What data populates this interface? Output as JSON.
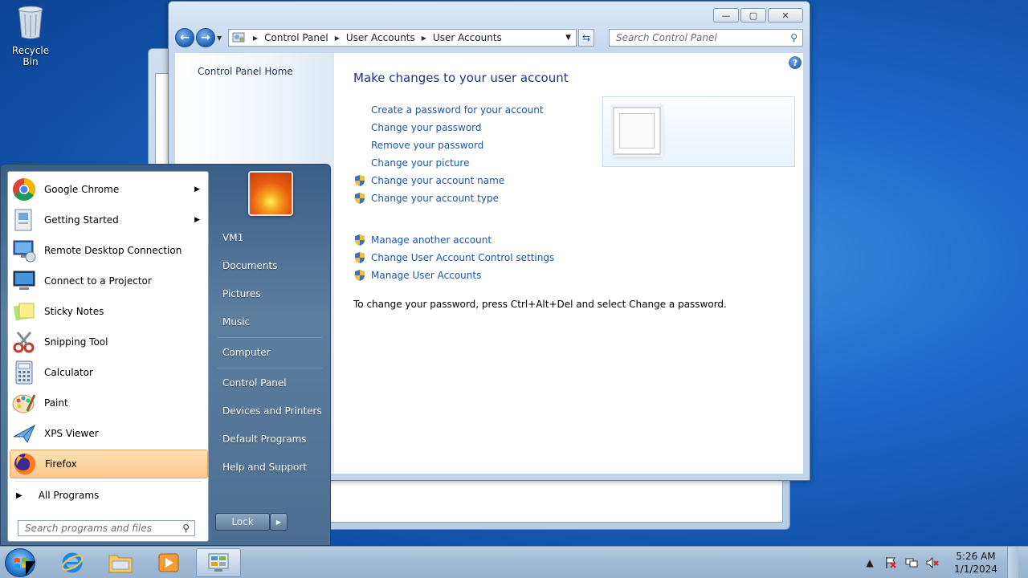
{
  "desktop": {
    "recycle_bin_label": "Recycle Bin"
  },
  "window": {
    "address": [
      "Control Panel",
      "User Accounts",
      "User Accounts"
    ],
    "search_placeholder": "Search Control Panel",
    "left_pane": {
      "home_link": "Control Panel Home"
    },
    "help_glyph": "?",
    "heading": "Make changes to your user account",
    "links": [
      {
        "label": "Create a password for your account",
        "shield": false
      },
      {
        "label": "Change your password",
        "shield": false
      },
      {
        "label": "Remove your password",
        "shield": false
      },
      {
        "label": "Change your picture",
        "shield": false
      },
      {
        "label": "Change your account name",
        "shield": true
      },
      {
        "label": "Change your account type",
        "shield": true
      }
    ],
    "links2": [
      {
        "label": "Manage another account",
        "shield": true
      },
      {
        "label": "Change User Account Control settings",
        "shield": true
      },
      {
        "label": "Manage User Accounts",
        "shield": true
      }
    ],
    "note": "To change your password, press Ctrl+Alt+Del and select Change a password."
  },
  "start_menu": {
    "programs": [
      {
        "label": "Google Chrome",
        "has_submenu": true,
        "icon": "chrome-icon"
      },
      {
        "label": "Getting Started",
        "has_submenu": true,
        "icon": "getting-started-icon"
      },
      {
        "label": "Remote Desktop Connection",
        "has_submenu": false,
        "icon": "remote-desktop-icon"
      },
      {
        "label": "Connect to a Projector",
        "has_submenu": false,
        "icon": "projector-icon"
      },
      {
        "label": "Sticky Notes",
        "has_submenu": false,
        "icon": "sticky-notes-icon"
      },
      {
        "label": "Snipping Tool",
        "has_submenu": false,
        "icon": "snipping-tool-icon"
      },
      {
        "label": "Calculator",
        "has_submenu": false,
        "icon": "calculator-icon"
      },
      {
        "label": "Paint",
        "has_submenu": false,
        "icon": "paint-icon"
      },
      {
        "label": "XPS Viewer",
        "has_submenu": false,
        "icon": "xps-viewer-icon"
      },
      {
        "label": "Firefox",
        "has_submenu": false,
        "icon": "firefox-icon",
        "highlighted": true
      }
    ],
    "all_programs": "All Programs",
    "search_placeholder": "Search programs and files",
    "right_items": [
      "VM1",
      "Documents",
      "Pictures",
      "Music",
      "Computer",
      "Control Panel",
      "Devices and Printers",
      "Default Programs",
      "Help and Support"
    ],
    "lock_label": "Lock"
  },
  "taskbar": {
    "pinned": [
      "internet-explorer-icon",
      "windows-explorer-icon",
      "media-player-icon",
      "control-panel-icon"
    ],
    "clock_time": "5:26 AM",
    "clock_date": "1/1/2024"
  },
  "colors": {
    "link": "#1a57a6",
    "heading": "#1e3287",
    "highlight": "#f9c78a"
  }
}
